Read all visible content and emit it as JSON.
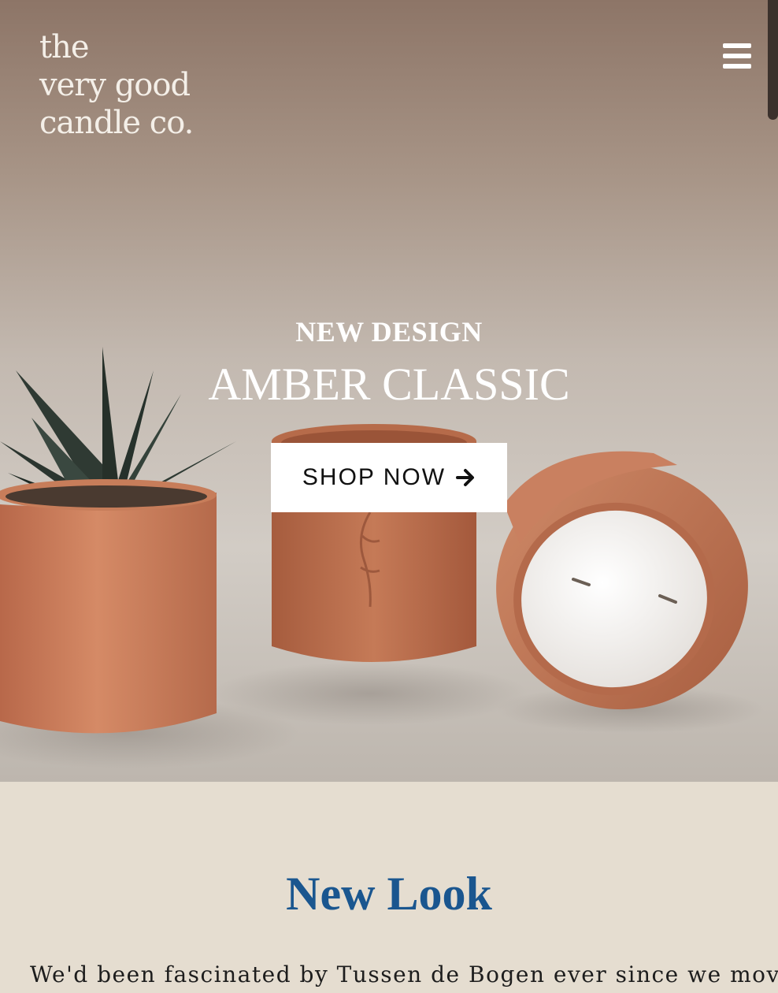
{
  "brand": {
    "logo_lines": [
      "the",
      "very good",
      "candle co."
    ]
  },
  "header": {
    "menu_icon": "hamburger-menu-icon"
  },
  "hero": {
    "eyebrow": "NEW DESIGN",
    "title": "AMBER CLASSIC",
    "cta_label": "SHOP NOW",
    "cta_icon": "arrow-right-icon"
  },
  "section": {
    "title": "New Look",
    "body": "We'd been fascinated by Tussen de Bogen ever since we moved"
  },
  "colors": {
    "accent_blue": "#1a568f",
    "section_background": "#e5ddd0",
    "button_background": "#ffffff",
    "terracotta": "#c27552"
  }
}
